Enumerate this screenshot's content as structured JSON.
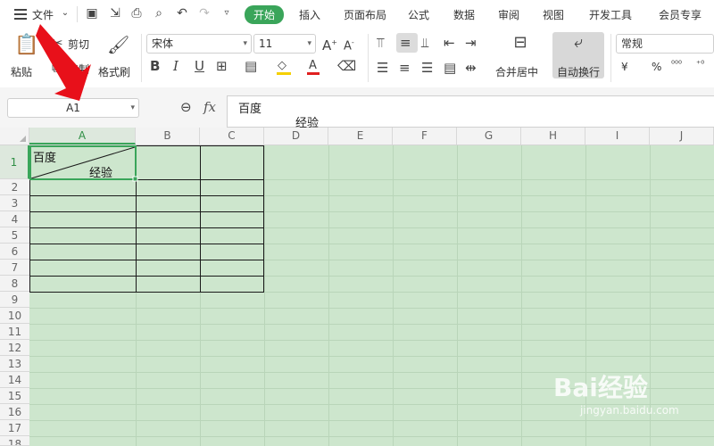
{
  "menubar": {
    "file_label": "文件",
    "tabs": [
      "开始",
      "插入",
      "页面布局",
      "公式",
      "数据",
      "审阅",
      "视图",
      "开发工具",
      "会员专享"
    ],
    "active_tab": "开始"
  },
  "ribbon": {
    "paste_label": "粘贴",
    "cut_label": "剪切",
    "copy_label": "复制",
    "format_painter_label": "格式刷",
    "font_name": "宋体",
    "font_size": "11",
    "merge_center_label": "合并居中",
    "wrap_text_label": "自动换行",
    "number_format": "常规",
    "currency_symbol": "¥",
    "percent_symbol": "%"
  },
  "formula_bar": {
    "name_box": "A1",
    "fx_label": "fx",
    "content_line1": "百度",
    "content_line2": "经验"
  },
  "grid": {
    "columns": [
      "A",
      "B",
      "C",
      "D",
      "E",
      "F",
      "G",
      "H",
      "I",
      "J"
    ],
    "rows": [
      "1",
      "2",
      "3",
      "4",
      "5",
      "6",
      "7",
      "8",
      "9",
      "10",
      "11",
      "12",
      "13",
      "14",
      "15",
      "16",
      "17",
      "18"
    ],
    "cell_a1_top": "百度",
    "cell_a1_bottom": "经验"
  },
  "watermark": {
    "brand": "Bai经验",
    "url": "jingyan.baidu.com"
  },
  "colors": {
    "accent_green": "#3aa55a",
    "sheet_background": "#cde6cd",
    "annotation_arrow": "#e8101a"
  }
}
